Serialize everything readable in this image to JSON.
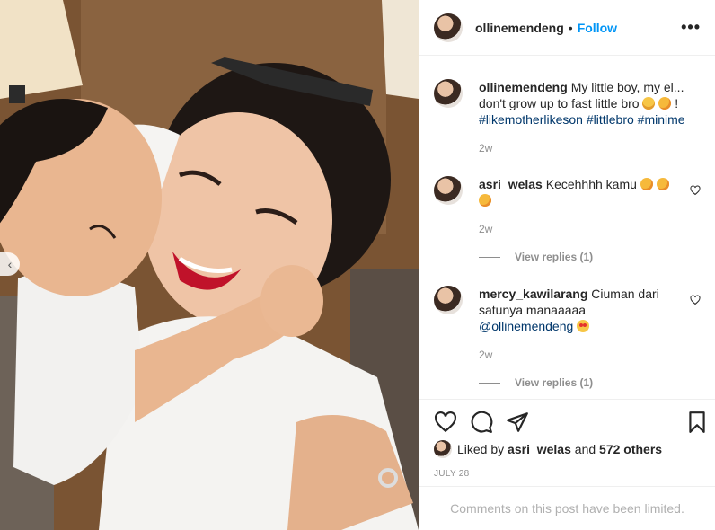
{
  "post": {
    "username": "ollinemendeng",
    "separator": "•",
    "follow_label": "Follow",
    "more_label": "•••",
    "photo_alt": "",
    "carousel_prev_icon": "chevron-left-icon"
  },
  "caption": {
    "username": "ollinemendeng",
    "text": "My little boy, my el... don't grow up to fast little bro",
    "emojis": [
      "grinning-emoji",
      "kissing-emoji"
    ],
    "trailing": "!",
    "hashtags": [
      "#likemotherlikeson",
      "#littlebro",
      "#minime"
    ],
    "age": "2w"
  },
  "comments": [
    {
      "username": "asri_welas",
      "text": "Kecehhhh kamu",
      "emojis": [
        "kissing-emoji",
        "kissing-emoji",
        "kissing-emoji"
      ],
      "age": "2w",
      "view_replies": "View replies (1)"
    },
    {
      "username": "mercy_kawilarang",
      "text": "Ciuman dari satunya manaaaaa",
      "mention": "@ollinemendeng",
      "emojis": [
        "heart-eyes-emoji"
      ],
      "age": "2w",
      "view_replies": "View replies (1)"
    }
  ],
  "likes": {
    "prefix": "Liked by",
    "user": "asri_welas",
    "and": "and",
    "others": "572 others"
  },
  "date": "JULY 28",
  "comments_limited": "Comments on this post have been limited.",
  "colors": {
    "link_blue": "#0095f6",
    "hashtag": "#00376b",
    "muted": "#8e8e8e"
  }
}
